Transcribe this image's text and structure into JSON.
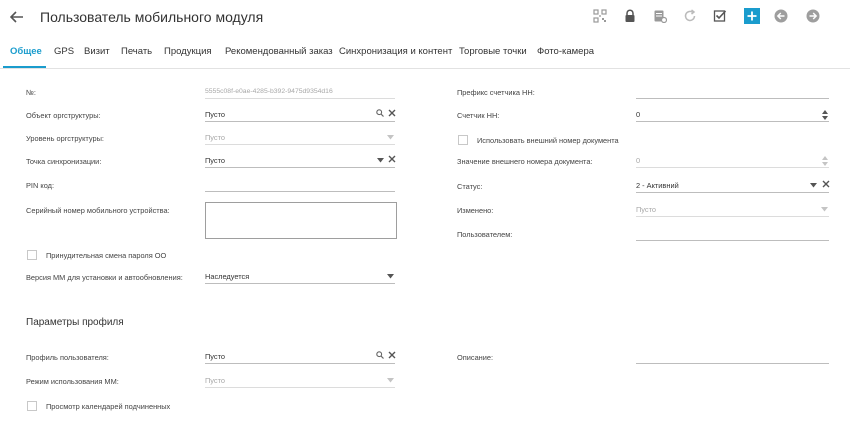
{
  "header": {
    "title": "Пользователь мобильного модуля",
    "back_icon": "arrow-left-icon",
    "toolbar_icons": [
      "qr-code-icon",
      "lock-icon",
      "database-settings-icon",
      "refresh-icon",
      "checkbox-checked-icon",
      "add-icon",
      "arrow-left-circle-icon",
      "arrow-right-circle-icon"
    ],
    "accent_color": "#1a9ccd"
  },
  "tabs": [
    {
      "label": "Общее",
      "active": true
    },
    {
      "label": "GPS"
    },
    {
      "label": "Визит"
    },
    {
      "label": "Печать"
    },
    {
      "label": "Продукция"
    },
    {
      "label": "Рекомендованный заказ"
    },
    {
      "label": "Синхронизация и контент"
    },
    {
      "label": "Торговые точки"
    },
    {
      "label": "Фото-камера"
    }
  ],
  "form": {
    "number": {
      "label": "№:",
      "value": "5555c08f-e0ae-4285-b392-9475d9354d16"
    },
    "org_object": {
      "label": "Объект оргструктуры:",
      "value": "Пусто"
    },
    "org_level": {
      "label": "Уровень оргструктуры:",
      "placeholder": "Пусто"
    },
    "sync_point": {
      "label": "Точка синхронизации:",
      "value": "Пусто"
    },
    "pin": {
      "label": "PIN код:",
      "value": ""
    },
    "serial": {
      "label": "Серийный номер мобильного устройства:",
      "value": ""
    },
    "force_pwd": {
      "label": "Принудительная смена пароля ОО",
      "checked": false
    },
    "mm_version": {
      "label": "Версия ММ для установки и автообновления:",
      "value": "Наследуется"
    },
    "prefix": {
      "label": "Префикс счетчика НН:",
      "value": ""
    },
    "counter": {
      "label": "Счетчик НН:",
      "value": "0"
    },
    "ext_num_use": {
      "label": "Использовать внешний номер документа",
      "checked": false
    },
    "ext_num_value": {
      "label": "Значение внешнего номера документа:",
      "placeholder": "0"
    },
    "status": {
      "label": "Статус:",
      "value": "2 - Активний"
    },
    "changed": {
      "label": "Изменено:",
      "placeholder": "Пусто"
    },
    "by_user": {
      "label": "Пользователем:",
      "value": ""
    }
  },
  "profile": {
    "section_title": "Параметры профиля",
    "user_profile": {
      "label": "Профиль пользователя:",
      "value": "Пусто"
    },
    "mm_mode": {
      "label": "Режим использования ММ:",
      "placeholder": "Пусто"
    },
    "view_calendars": {
      "label": "Просмотр календарей подчиненных",
      "checked": false
    },
    "description": {
      "label": "Описание:",
      "value": ""
    }
  }
}
